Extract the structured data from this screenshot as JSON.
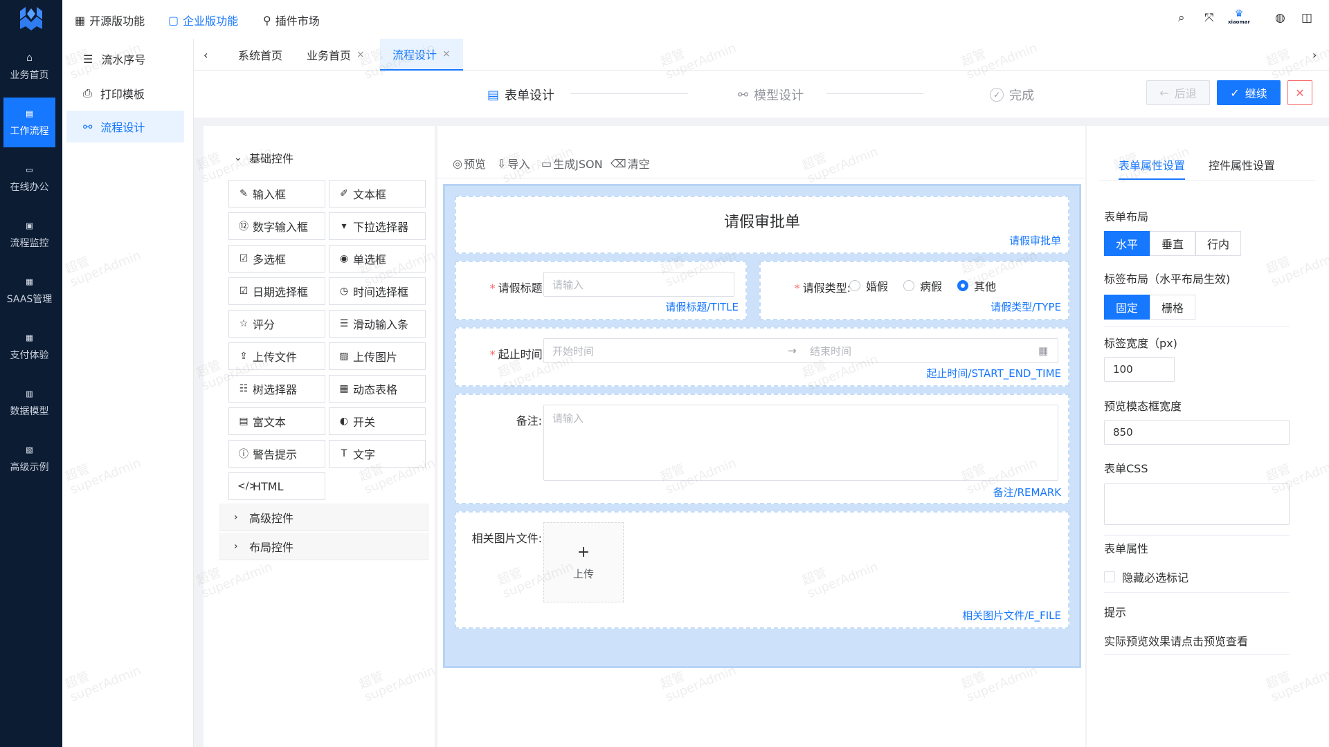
{
  "rail": {
    "items": [
      {
        "label": "业务首页",
        "icon": "home-icon",
        "glyph": "⌂"
      },
      {
        "label": "工作流程",
        "icon": "workflow-icon",
        "glyph": "▤"
      },
      {
        "label": "在线办公",
        "icon": "monitor-icon",
        "glyph": "▭"
      },
      {
        "label": "流程监控",
        "icon": "monitor-chart-icon",
        "glyph": "▣"
      },
      {
        "label": "SAAS管理",
        "icon": "grid-icon",
        "glyph": "▦"
      },
      {
        "label": "支付体验",
        "icon": "payment-icon",
        "glyph": "▦"
      },
      {
        "label": "数据模型",
        "icon": "data-model-icon",
        "glyph": "▥"
      },
      {
        "label": "高级示例",
        "icon": "example-icon",
        "glyph": "▧"
      }
    ]
  },
  "topnav": {
    "links": [
      {
        "label": "开源版功能",
        "icon": "apps-icon",
        "glyph": "▦"
      },
      {
        "label": "企业版功能",
        "icon": "enterprise-icon",
        "glyph": "▢"
      },
      {
        "label": "插件市场",
        "icon": "plugin-icon",
        "glyph": "⚲"
      }
    ],
    "brand_text": "xiaomar"
  },
  "subside": {
    "items": [
      {
        "label": "流水序号",
        "glyph": "☰"
      },
      {
        "label": "打印模板",
        "glyph": "⎙"
      },
      {
        "label": "流程设计",
        "glyph": "⚯"
      }
    ]
  },
  "tabs": [
    {
      "label": "系统首页"
    },
    {
      "label": "业务首页",
      "close": "×"
    },
    {
      "label": "流程设计",
      "close": "×"
    }
  ],
  "steps": [
    {
      "label": "表单设计",
      "glyph": "▤"
    },
    {
      "label": "模型设计",
      "glyph": "⚯"
    },
    {
      "label": "完成",
      "glyph": "✓"
    }
  ],
  "actions": {
    "back": "后退",
    "continue": "继续",
    "back_glyph": "←",
    "continue_glyph": "✓",
    "close_glyph": "✕"
  },
  "palette": {
    "category_basic": "基础控件",
    "category_advanced": "高级控件",
    "category_layout": "布局控件",
    "basic_items": [
      {
        "label": "输入框",
        "glyph": "✎"
      },
      {
        "label": "文本框",
        "glyph": "✐"
      },
      {
        "label": "数字输入框",
        "glyph": "⑫"
      },
      {
        "label": "下拉选择器",
        "glyph": "▾"
      },
      {
        "label": "多选框",
        "glyph": "☑"
      },
      {
        "label": "单选框",
        "glyph": "◉"
      },
      {
        "label": "日期选择框",
        "glyph": "☑"
      },
      {
        "label": "时间选择框",
        "glyph": "◷"
      },
      {
        "label": "评分",
        "glyph": "☆"
      },
      {
        "label": "滑动输入条",
        "glyph": "☰"
      },
      {
        "label": "上传文件",
        "glyph": "⇪"
      },
      {
        "label": "上传图片",
        "glyph": "▨"
      },
      {
        "label": "树选择器",
        "glyph": "☷"
      },
      {
        "label": "动态表格",
        "glyph": "▦"
      },
      {
        "label": "富文本",
        "glyph": "▤"
      },
      {
        "label": "开关",
        "glyph": "◐"
      },
      {
        "label": "警告提示",
        "glyph": "ⓘ"
      },
      {
        "label": "文字",
        "glyph": "T"
      },
      {
        "label": "HTML",
        "glyph": "</>"
      }
    ]
  },
  "toolbar": {
    "preview": "预览",
    "import": "导入",
    "json": "生成JSON",
    "clear": "清空"
  },
  "form": {
    "title": "请假审批单",
    "title_key": "请假审批单",
    "fields": {
      "leave_title": {
        "label": "请假标题:",
        "placeholder": "请输入",
        "key": "请假标题/TITLE"
      },
      "leave_type": {
        "label": "请假类型:",
        "options": [
          "婚假",
          "病假",
          "其他"
        ],
        "selected": "其他",
        "key": "请假类型/TYPE"
      },
      "time_range": {
        "label": "起止时间:",
        "start_placeholder": "开始时间",
        "end_placeholder": "结束时间",
        "arrow": "→",
        "key": "起止时间/START_END_TIME"
      },
      "remark": {
        "label": "备注:",
        "placeholder": "请输入",
        "key": "备注/REMARK"
      },
      "files": {
        "label": "相关图片文件:",
        "upload_plus": "+",
        "upload_text": "上传",
        "key": "相关图片文件/E_FILE"
      }
    }
  },
  "props": {
    "tab_form": "表单属性设置",
    "tab_control": "控件属性设置",
    "layout_label": "表单布局",
    "layout_options": [
      "水平",
      "垂直",
      "行内"
    ],
    "layout_selected": "水平",
    "label_layout_label": "标签布局（水平布局生效)",
    "label_layout_options": [
      "固定",
      "栅格"
    ],
    "label_layout_selected": "固定",
    "label_width_label": "标签宽度（px)",
    "label_width_value": "100",
    "modal_width_label": "预览模态框宽度",
    "modal_width_value": "850",
    "css_label": "表单CSS",
    "form_attr_label": "表单属性",
    "hide_required_label": "隐藏必选标记",
    "hint_title": "提示",
    "hint_text": "实际预览效果请点击预览查看"
  },
  "watermark": "超管\nsuperAdmin",
  "colors": {
    "primary": "#1677ff",
    "rail_bg": "#0c1c33",
    "danger": "#f56c6c"
  }
}
